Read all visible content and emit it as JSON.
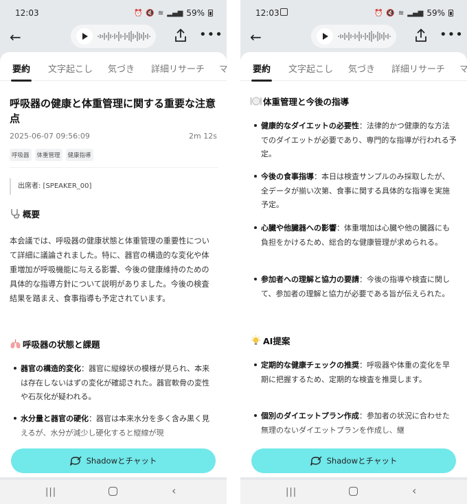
{
  "screens": [
    {
      "status": {
        "time": "12:03",
        "battery": "59%"
      },
      "tabs": [
        "要約",
        "文字起こし",
        "気づき",
        "詳細リサーチ",
        "マ"
      ],
      "title": "呼吸器の健康と体重管理に関する重要な注意点",
      "date": "2025-06-07 09:56:09",
      "duration": "2m 12s",
      "tags": [
        "呼吸器",
        "体重管理",
        "健康指導"
      ],
      "attendee": "出席者: [SPEAKER_00]",
      "overview": {
        "heading": "概要",
        "icon": "stethoscope-icon",
        "text": "本会議では、呼吸器の健康状態と体重管理の重要性について詳細に議論されました。特に、器官の構造的な変化や体重増加が呼吸機能に与える影響、今後の健康維持のための具体的な指導方針について説明がありました。今後の検査結果を踏まえ、食事指導も予定されています。"
      },
      "section": {
        "heading": "呼吸器の状態と課題",
        "icon": "lungs-icon",
        "bullets": [
          {
            "label": "器官の構造的変化",
            "text": "：器官に縦線状の模様が見られ、本来は存在しないはずの変化が確認された。器官軟骨の変性や石灰化が疑われる。"
          },
          {
            "label": "水分量と器官の硬化",
            "text": "：器官は本来水分を多く含み黒く見えるが、水分が減少し硬化すると縦線が現"
          }
        ]
      },
      "chat_button": "Shadowとチャット"
    },
    {
      "status": {
        "time": "12:03",
        "battery": "59%"
      },
      "tabs": [
        "要約",
        "文字起こし",
        "気づき",
        "詳細リサーチ",
        "マ"
      ],
      "section1": {
        "heading": "体重管理と今後の指導",
        "icon": "plate-icon",
        "bullets": [
          {
            "label": "健康的なダイエットの必要性",
            "text": "：法律的かつ健康的な方法でのダイエットが必要であり、専門的な指導が行われる予定。"
          },
          {
            "label": "今後の食事指導",
            "text": "：本日は検査サンプルのみ採取したが、全データが揃い次第、食事に関する具体的な指導を実施予定。"
          },
          {
            "label": "心臓や他臓器への影響",
            "text": "：体重増加は心臓や他の臓器にも負担をかけるため、総合的な健康管理が求められる。"
          },
          {
            "label": "参加者への理解と協力の要請",
            "text": "：今後の指導や検査に関して、参加者の理解と協力が必要である旨が伝えられた。"
          }
        ]
      },
      "section2": {
        "heading": "AI提案",
        "icon": "lightbulb-icon",
        "bullets": [
          {
            "label": "定期的な健康チェックの推奨",
            "text": "：呼吸器や体重の変化を早期に把握するため、定期的な検査を推奨します。"
          },
          {
            "label": "個別のダイエットプラン作成",
            "text": "：参加者の状況に合わせた無理のないダイエットプランを作成し、継"
          }
        ]
      },
      "chat_button": "Shadowとチャット"
    }
  ]
}
